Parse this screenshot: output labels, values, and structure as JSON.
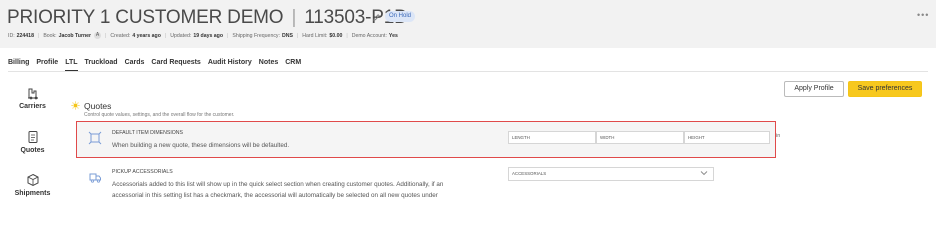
{
  "header": {
    "company_name": "PRIORITY 1 CUSTOMER DEMO",
    "title_separator": "|",
    "customer_code": "113503-P1D",
    "status_badge": "On Hold",
    "more_icon": "more-horizontal-icon",
    "meta": {
      "id_label": "ID:",
      "id_value": "224418",
      "book_label": "Book:",
      "book_value": "Jacob Turner",
      "book_badge": "A",
      "created_label": "Created:",
      "created_value": "4 years ago",
      "updated_label": "Updated:",
      "updated_value": "19 days ago",
      "shipping_label": "Shipping Frequency:",
      "shipping_value": "DNS",
      "hardlimit_label": "Hard Limit:",
      "hardlimit_value": "$0.00",
      "demo_label": "Demo Account:",
      "demo_value": "Yes"
    }
  },
  "tabs": [
    {
      "label": "Billing",
      "active": false
    },
    {
      "label": "Profile",
      "active": false
    },
    {
      "label": "LTL",
      "active": true
    },
    {
      "label": "Truckload",
      "active": false
    },
    {
      "label": "Cards",
      "active": false
    },
    {
      "label": "Card Requests",
      "active": false
    },
    {
      "label": "Audit History",
      "active": false
    },
    {
      "label": "Notes",
      "active": false
    },
    {
      "label": "CRM",
      "active": false
    }
  ],
  "sidebar": {
    "items": [
      {
        "label": "Carriers",
        "icon": "carriers-icon"
      },
      {
        "label": "Quotes",
        "icon": "quotes-icon"
      },
      {
        "label": "Shipments",
        "icon": "shipments-icon"
      }
    ]
  },
  "section": {
    "title": "Quotes",
    "subtitle": "Control quote values, settings, and the overall flow for the customer.",
    "icon": "sun-icon"
  },
  "actions": {
    "apply_profile": "Apply Profile",
    "save_preferences": "Save preferences",
    "save_color": "#f7c81e"
  },
  "settings": {
    "dimensions": {
      "title": "DEFAULT ITEM DIMENSIONS",
      "description": "When building a new quote, these dimensions will be defaulted.",
      "length_placeholder": "LENGTH",
      "width_placeholder": "WIDTH",
      "height_placeholder": "HEIGHT",
      "unit": "in",
      "icon": "dimensions-icon"
    },
    "accessorials": {
      "title": "PICKUP ACCESSORIALS",
      "description_line1": "Accessorials added to this list will show up in the quick select section when creating customer quotes. Additionally, if an",
      "description_line2": "accessorial in this setting list has a checkmark, the accessorial will automatically be selected on all new quotes under",
      "select_placeholder": "ACCESSORIALS",
      "icon": "pickup-truck-icon"
    }
  },
  "highlight_color": "#e04a4a"
}
